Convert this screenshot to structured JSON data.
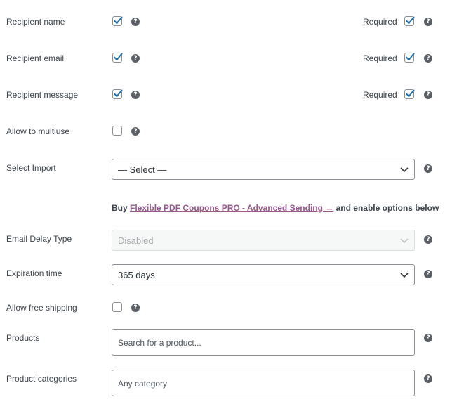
{
  "fields": {
    "recipient_name": {
      "label": "Recipient name",
      "enabled": true,
      "required_label": "Required",
      "required": true
    },
    "recipient_email": {
      "label": "Recipient email",
      "enabled": true,
      "required_label": "Required",
      "required": true
    },
    "recipient_message": {
      "label": "Recipient message",
      "enabled": true,
      "required_label": "Required",
      "required": true
    },
    "allow_multiuse": {
      "label": "Allow to multiuse",
      "enabled": false
    },
    "select_import": {
      "label": "Select Import",
      "value": "— Select —"
    },
    "promo": {
      "prefix": "Buy",
      "link_text": "Flexible PDF Coupons PRO - Advanced Sending →",
      "suffix": "and enable options below"
    },
    "email_delay_type": {
      "label": "Email Delay Type",
      "value": "Disabled",
      "disabled": true
    },
    "expiration_time": {
      "label": "Expiration time",
      "value": "365 days"
    },
    "allow_free_shipping": {
      "label": "Allow free shipping",
      "enabled": false
    },
    "products": {
      "label": "Products",
      "placeholder": "Search for a product..."
    },
    "product_categories": {
      "label": "Product categories",
      "placeholder": "Any category"
    }
  },
  "help_glyph": "?",
  "icons": {
    "help": "help-circle-icon",
    "check": "checkmark-icon",
    "dropdown": "chevron-down-icon"
  },
  "colors": {
    "checkmark": "#2271b1",
    "link": "#96588a",
    "help_bg": "#5a5f66"
  }
}
